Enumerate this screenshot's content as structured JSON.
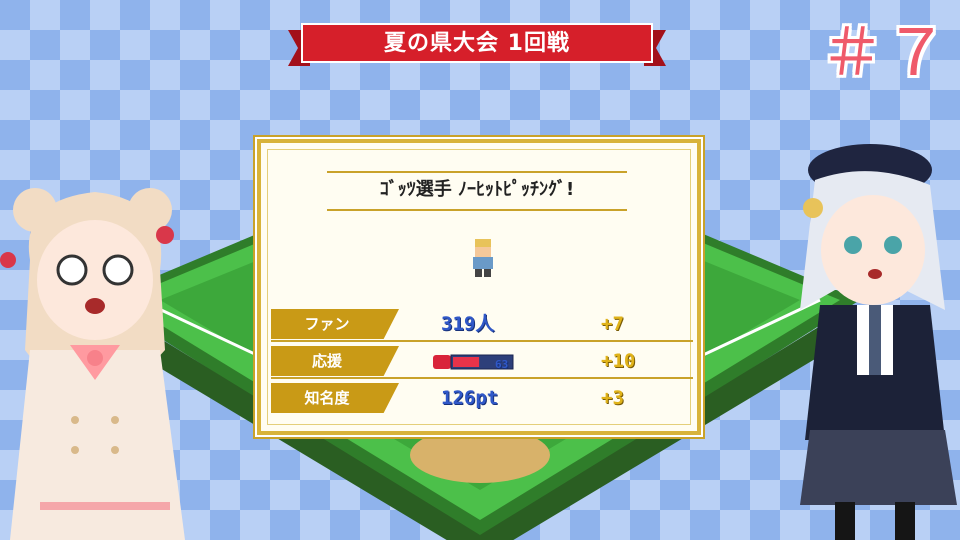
{
  "banner": {
    "title": "夏の県大会 1回戦",
    "color": "#d61f2a"
  },
  "episode": {
    "label": "＃７"
  },
  "event": {
    "title": "ｺﾞｯﾂ選手 ﾉｰﾋｯﾄﾋﾟｯﾁﾝｸﾞ!"
  },
  "stats": [
    {
      "label": "ファン",
      "value": "319人",
      "increase": "+7"
    },
    {
      "label": "応援",
      "value": "63",
      "increase": "+10",
      "gauge_fraction": 0.45
    },
    {
      "label": "知名度",
      "value": "126pt",
      "increase": "+3"
    }
  ],
  "colors": {
    "label_bg": "#c99a16",
    "value": "#3058c8",
    "increase": "#e0b31a",
    "panel_border": "#d8b33a",
    "field_green": "#3fb23c"
  }
}
